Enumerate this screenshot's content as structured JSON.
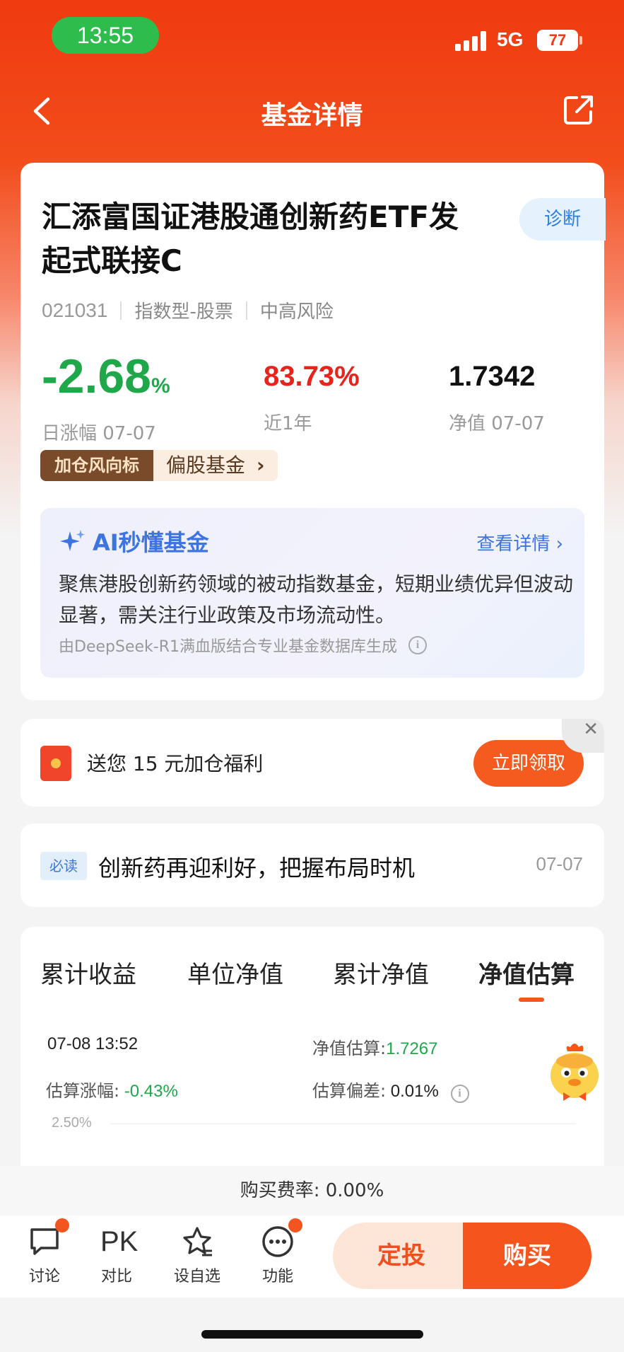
{
  "status_bar": {
    "time": "13:55",
    "network": "5G",
    "battery": "77"
  },
  "nav": {
    "title": "基金详情",
    "back_icon": "chevron-left-icon",
    "share_icon": "share-icon"
  },
  "fund": {
    "name": "汇添富国证港股通创新药ETF发起式联接C",
    "diagnose_label": "诊断",
    "code": "021031",
    "type": "指数型-股票",
    "risk": "中高风险",
    "daily_change": "-2.68",
    "daily_change_unit": "%",
    "daily_change_label": "日涨幅 07-07",
    "year_return": "83.73%",
    "year_return_label": "近1年",
    "nav_value": "1.7342",
    "nav_label": "净值 07-07",
    "tag_primary": "加仓风向标",
    "tag_secondary": "偏股基金"
  },
  "ai_summary": {
    "title": "AI秒懂基金",
    "link": "查看详情",
    "text": "聚焦港股创新药领域的被动指数基金，短期业绩优异但波动显著，需关注行业政策及市场流动性。",
    "source": "由DeepSeek-R1满血版结合专业基金数据库生成"
  },
  "bonus": {
    "text": "送您 15 元加仓福利",
    "button": "立即领取"
  },
  "news": {
    "badge": "必读",
    "title": "创新药再迎利好，把握布局时机",
    "date": "07-07"
  },
  "chart_tabs": [
    "累计收益",
    "单位净值",
    "累计净值",
    "净值估算"
  ],
  "estimate": {
    "time": "07-08 13:52",
    "value_label": "净值估算:",
    "value": "1.7267",
    "change_label": "估算涨幅:",
    "change": "-0.43%",
    "deviation_label": "估算偏差:",
    "deviation": "0.01%",
    "y_tick": "2.50%"
  },
  "fee": {
    "text": "购买费率: 0.00%"
  },
  "toolbar": {
    "discuss": "讨论",
    "pk_glyph": "PK",
    "compare": "对比",
    "watchlist": "设自选",
    "functions": "功能",
    "dingtou": "定投",
    "buy": "购买"
  },
  "colors": {
    "brand": "#f03a10",
    "up_red": "#e8231c",
    "down_green": "#1fa84a",
    "accent_blue": "#3d74e0"
  }
}
